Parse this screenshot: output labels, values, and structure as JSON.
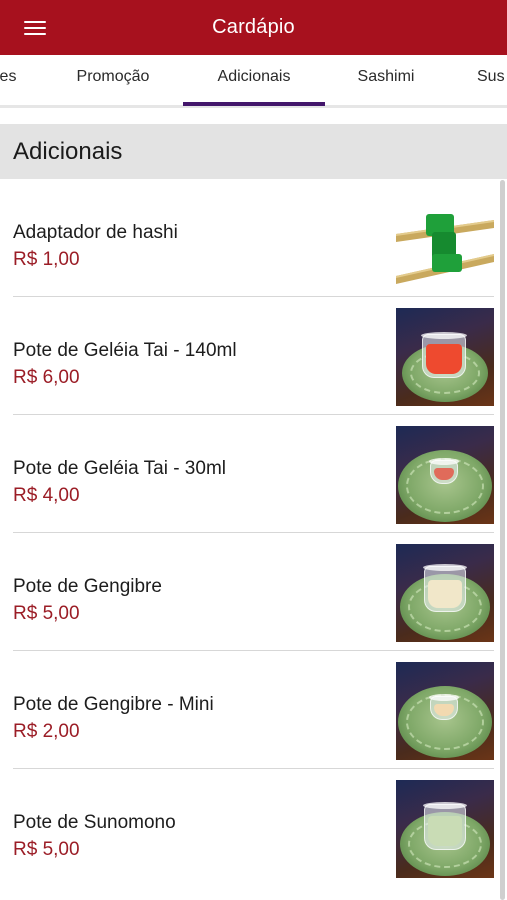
{
  "app": {
    "title": "Cardápio"
  },
  "tabs": [
    {
      "label": "es"
    },
    {
      "label": "Promoção"
    },
    {
      "label": "Adicionais",
      "selected": true
    },
    {
      "label": "Sashimi"
    },
    {
      "label": "Sus"
    }
  ],
  "section": {
    "title": "Adicionais"
  },
  "items": [
    {
      "name": "Adaptador de hashi",
      "price": "R$ 1,00"
    },
    {
      "name": "Pote de Geléia Tai - 140ml",
      "price": "R$ 6,00"
    },
    {
      "name": "Pote de Geléia Tai - 30ml",
      "price": "R$ 4,00"
    },
    {
      "name": "Pote de Gengibre",
      "price": "R$ 5,00"
    },
    {
      "name": "Pote de Gengibre - Mini",
      "price": "R$ 2,00"
    },
    {
      "name": "Pote de Sunomono",
      "price": "R$ 5,00"
    }
  ],
  "colors": {
    "appbar": "#a7111e",
    "tab_indicator": "#43166b",
    "price": "#9b1d26",
    "section_bg": "#e3e3e3"
  }
}
